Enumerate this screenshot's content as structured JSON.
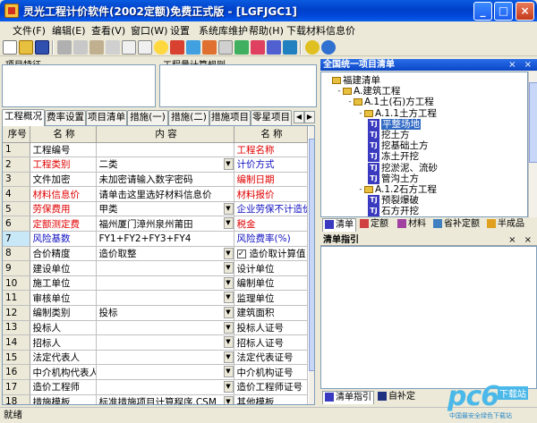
{
  "window": {
    "title": "灵光工程计价软件(2002定额)免费正式版 - [LGFJGC1]",
    "buttons": [
      "_",
      "□",
      "×"
    ]
  },
  "menu": [
    "文件(F)",
    "编辑(E)",
    "查看(V)",
    "窗口(W)",
    "设置",
    "系统库维护",
    "帮助(H)",
    "下载材料信息价"
  ],
  "panels": {
    "project_feature_label": "项目特征",
    "calc_rule_label": "工程量计算规则"
  },
  "tabs": [
    "工程概况",
    "费率设置",
    "项目清单",
    "措施(一)",
    "措施(二)",
    "措施项目",
    "零星项目"
  ],
  "grid": {
    "headers": [
      "序号",
      "名 称",
      "内 容",
      "名 称"
    ],
    "rows": [
      {
        "no": "1",
        "name": "工程编号",
        "content": "",
        "name2": "工程名称",
        "name_color": "black",
        "name2_color": "red",
        "dropdown": false
      },
      {
        "no": "2",
        "name": "工程类别",
        "content": "二类",
        "name2": "计价方式",
        "name_color": "red",
        "name2_color": "blue",
        "dropdown": true
      },
      {
        "no": "3",
        "name": "文件加密",
        "content": "未加密请输入数字密码",
        "name2": "编制日期",
        "name_color": "black",
        "name2_color": "red",
        "dropdown": false
      },
      {
        "no": "4",
        "name": "材料信息价",
        "content": "请单击这里选好材料信息价",
        "name2": "材料报价",
        "name_color": "red",
        "name2_color": "red",
        "dropdown": false
      },
      {
        "no": "5",
        "name": "劳保费用",
        "content": "甲类",
        "name2": "企业劳保不计造价",
        "name_color": "red",
        "name2_color": "blue",
        "dropdown": true
      },
      {
        "no": "6",
        "name": "定额测定费",
        "content": "福州厦门漳州泉州莆田",
        "name2": "税金",
        "name_color": "red",
        "name2_color": "red",
        "dropdown": true
      },
      {
        "no": "7",
        "name": "风险基数",
        "content": "FY1+FY2+FY3+FY4",
        "name2": "风险费率(%)",
        "name_color": "blue",
        "name2_color": "blue",
        "dropdown": false
      },
      {
        "no": "8",
        "name": "合价精度",
        "content": "造价取整",
        "name2": "造价取计算值",
        "name_color": "black",
        "name2_color": "black",
        "dropdown": true,
        "checkbox": true
      },
      {
        "no": "9",
        "name": "建设单位",
        "content": "",
        "name2": "设计单位",
        "name_color": "black",
        "name2_color": "black",
        "dropdown": true
      },
      {
        "no": "10",
        "name": "施工单位",
        "content": "",
        "name2": "编制单位",
        "name_color": "black",
        "name2_color": "black",
        "dropdown": true
      },
      {
        "no": "11",
        "name": "审核单位",
        "content": "",
        "name2": "监理单位",
        "name_color": "black",
        "name2_color": "black",
        "dropdown": true
      },
      {
        "no": "12",
        "name": "编制类别",
        "content": "投标",
        "name2": "建筑面积",
        "name_color": "black",
        "name2_color": "black",
        "dropdown": true
      },
      {
        "no": "13",
        "name": "投标人",
        "content": "",
        "name2": "投标人证号",
        "name_color": "black",
        "name2_color": "black",
        "dropdown": true
      },
      {
        "no": "14",
        "name": "招标人",
        "content": "",
        "name2": "招标人证号",
        "name_color": "black",
        "name2_color": "black",
        "dropdown": true
      },
      {
        "no": "15",
        "name": "法定代表人",
        "content": "",
        "name2": "法定代表证号",
        "name_color": "black",
        "name2_color": "black",
        "dropdown": true
      },
      {
        "no": "16",
        "name": "中介机构代表人",
        "content": "",
        "name2": "中介机构证号",
        "name_color": "black",
        "name2_color": "black",
        "dropdown": true
      },
      {
        "no": "17",
        "name": "造价工程师",
        "content": "",
        "name2": "造价工程师证号",
        "name_color": "black",
        "name2_color": "black",
        "dropdown": true
      },
      {
        "no": "18",
        "name": "措施模板",
        "content": "标准措施项目计算程序.CSM",
        "name2": "其他模板",
        "name_color": "black",
        "name2_color": "black",
        "dropdown": true
      },
      {
        "no": "19",
        "name": "规费模板",
        "content": "标准规费计算程序.CSM",
        "name2": "",
        "name_color": "black",
        "name2_color": "black",
        "dropdown": true
      }
    ]
  },
  "right_panel": {
    "title": "全国统一项目清单",
    "controls": "× ×",
    "tree": [
      {
        "label": "福建清单",
        "level": 0,
        "type": "folder",
        "expander": ""
      },
      {
        "label": "A.建筑工程",
        "level": 1,
        "type": "folder",
        "expander": "-"
      },
      {
        "label": "A.1土(石)方工程",
        "level": 2,
        "type": "folder",
        "expander": "-"
      },
      {
        "label": "A.1.1土方工程",
        "level": 3,
        "type": "folder",
        "expander": "-"
      },
      {
        "label": "平整场地",
        "level": 4,
        "type": "TJ",
        "selected": true
      },
      {
        "label": "挖土方",
        "level": 4,
        "type": "TJ"
      },
      {
        "label": "挖基础土方",
        "level": 4,
        "type": "TJ"
      },
      {
        "label": "冻土开挖",
        "level": 4,
        "type": "TJ"
      },
      {
        "label": "挖淤泥、流砂",
        "level": 4,
        "type": "TJ"
      },
      {
        "label": "管沟土方",
        "level": 4,
        "type": "TJ"
      },
      {
        "label": "A.1.2石方工程",
        "level": 3,
        "type": "folder",
        "expander": "-"
      },
      {
        "label": "预裂爆破",
        "level": 4,
        "type": "TJ"
      },
      {
        "label": "石方开挖",
        "level": 4,
        "type": "TJ"
      }
    ],
    "tabs": [
      "清单",
      "定额",
      "材料",
      "省补定额",
      "半成品"
    ],
    "guide_title": "清单指引",
    "bottom_tabs": [
      "清单指引",
      "自补定"
    ]
  },
  "status": "就绪",
  "watermark": {
    "big": "pc6",
    "tag": "下载站",
    "sub": "中国最安全绿色下载站"
  }
}
